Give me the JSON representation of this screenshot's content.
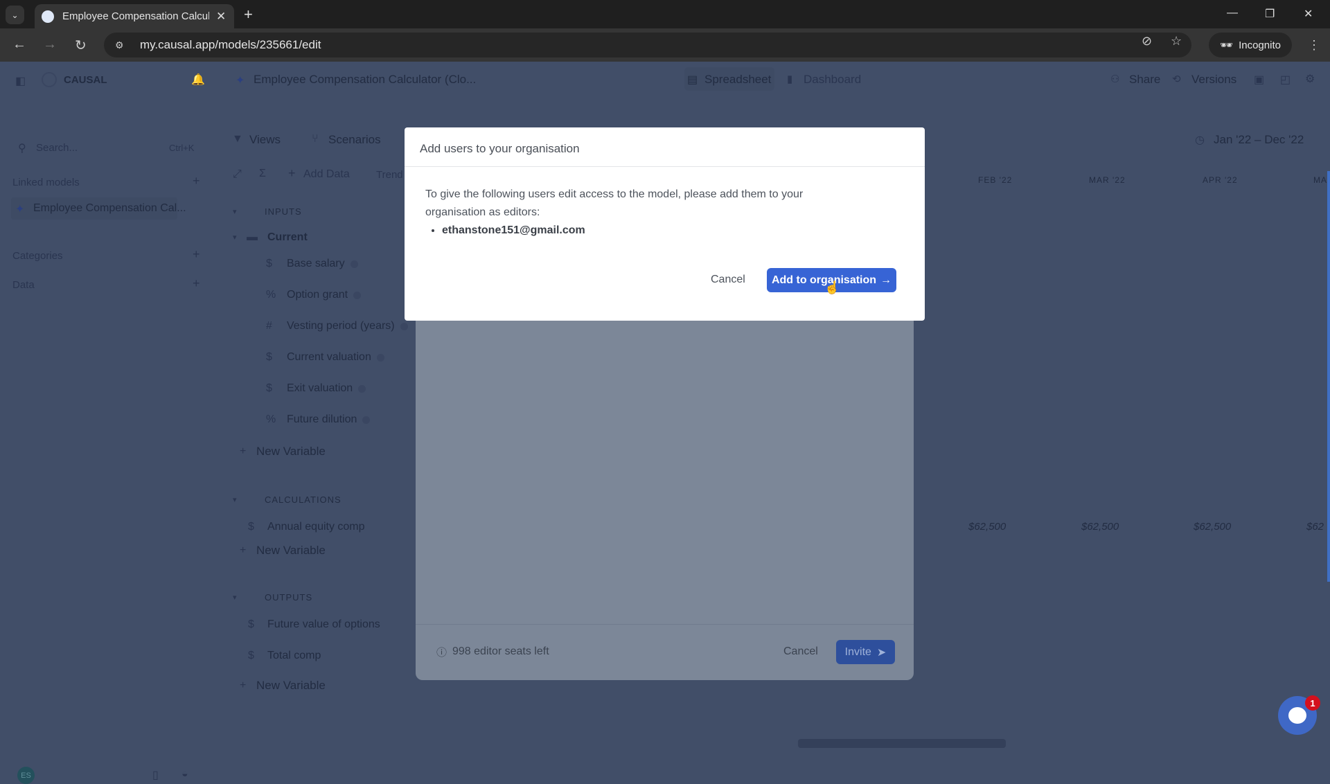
{
  "browser": {
    "tab_title": "Employee Compensation Calcul",
    "url": "my.causal.app/models/235661/edit",
    "incognito_label": "Incognito"
  },
  "app": {
    "brand": "CAUSAL",
    "model_title": "Employee Compensation Calculator (Clo...",
    "view_tabs": [
      "Spreadsheet",
      "Dashboard"
    ],
    "header_actions": [
      "Share",
      "Versions"
    ],
    "search_placeholder": "Search...",
    "search_shortcut": "Ctrl+K",
    "sidebar": {
      "linked_models_label": "Linked models",
      "linked_model": "Employee Compensation Cal...",
      "categories_label": "Categories",
      "data_label": "Data",
      "avatar_initials": "ES"
    },
    "toolbar": {
      "views": "Views",
      "scenarios": "Scenarios",
      "add_data": "Add Data",
      "trend": "Trend",
      "date_range": "Jan '22 – Dec '22"
    },
    "months": [
      "FEB '22",
      "MAR '22",
      "APR '22",
      "MA"
    ],
    "sections": {
      "inputs": "INPUTS",
      "calculations": "CALCULATIONS",
      "outputs": "OUTPUTS",
      "current_group": "Current",
      "input_vars": [
        {
          "icon": "$",
          "name": "Base salary"
        },
        {
          "icon": "%",
          "name": "Option grant"
        },
        {
          "icon": "#",
          "name": "Vesting period (years)"
        },
        {
          "icon": "$",
          "name": "Current valuation"
        },
        {
          "icon": "$",
          "name": "Exit valuation"
        },
        {
          "icon": "%",
          "name": "Future dilution"
        }
      ],
      "calc_vars": [
        {
          "icon": "$",
          "name": "Annual equity comp",
          "values": [
            "$62,500",
            "$62,500",
            "$62,500",
            "$62"
          ]
        }
      ],
      "output_vars": [
        {
          "icon": "$",
          "name": "Future value of options"
        },
        {
          "icon": "$",
          "name": "Total comp"
        }
      ],
      "new_variable": "New Variable"
    },
    "chat_badge": "1"
  },
  "invite_modal": {
    "seats_left": "998 editor seats left",
    "cancel": "Cancel",
    "invite": "Invite"
  },
  "dialog": {
    "title": "Add users to your organisation",
    "message": "To give the following users edit access to the model, please add them to your organisation as editors:",
    "emails": [
      "ethanstone151@gmail.com"
    ],
    "cancel": "Cancel",
    "confirm": "Add to organisation",
    "confirm_color": "#3764d5"
  }
}
